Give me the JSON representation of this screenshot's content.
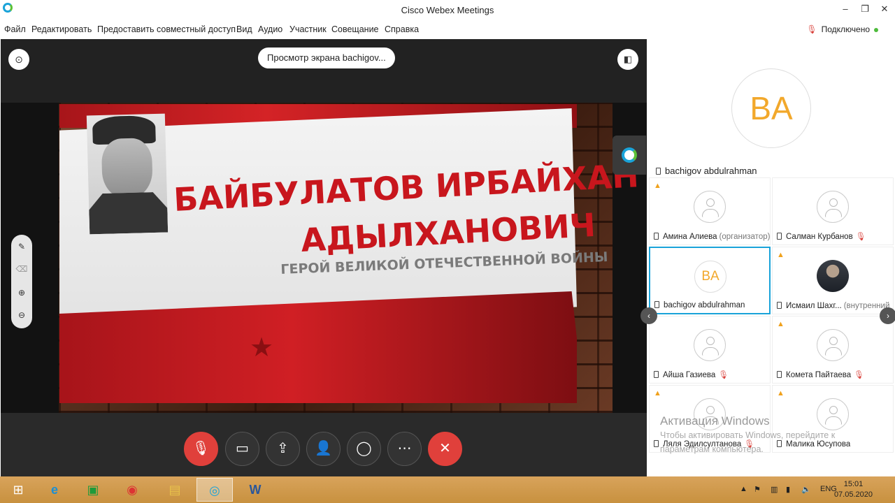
{
  "window": {
    "title": "Cisco Webex Meetings",
    "minimize": "–",
    "restore": "❐",
    "close": "✕"
  },
  "menu": [
    "Файл",
    "Редактировать",
    "Предоставить совместный доступ",
    "Вид",
    "Аудио",
    "Участник",
    "Совещание",
    "Справка"
  ],
  "status": {
    "label": "Подключено",
    "color": "#4dbb3b"
  },
  "stage": {
    "share_label": "Просмотр экрана bachigov...",
    "info_icon": "info-icon",
    "layout_icon": "layout-toggle-icon"
  },
  "slide": {
    "title_line1": "БАЙБУЛАТОВ ИРБАЙХАН",
    "title_line2": "АДЫЛХАНОВИЧ",
    "subtitle": "ГЕРОЙ ВЕЛИКОЙ ОТЕЧЕСТВЕННОЙ ВОЙНЫ",
    "accent": "#c8161d"
  },
  "side_tools": [
    "annotate-icon",
    "eraser-icon",
    "zoom-in-icon",
    "zoom-out-icon"
  ],
  "controls": [
    {
      "name": "mute-button",
      "icon": "microphone-muted-icon",
      "glyph": "🎙",
      "red": true
    },
    {
      "name": "video-button",
      "icon": "camera-off-icon",
      "glyph": "▭",
      "red": false
    },
    {
      "name": "share-button",
      "icon": "share-icon",
      "glyph": "⇪",
      "red": false
    },
    {
      "name": "participants-button",
      "icon": "participants-icon",
      "glyph": "👤",
      "red": false
    },
    {
      "name": "chat-button",
      "icon": "chat-icon",
      "glyph": "◯",
      "red": false
    },
    {
      "name": "more-button",
      "icon": "more-icon",
      "glyph": "⋯",
      "red": false
    },
    {
      "name": "leave-button",
      "icon": "close-icon",
      "glyph": "✕",
      "red": true
    }
  ],
  "panel": {
    "active_speaker_initials": "BA",
    "active_speaker_name": "bachigov abdulrahman",
    "participants": [
      {
        "name": "Амина Алиева",
        "role": "(организатор)",
        "initials": "",
        "muted": false,
        "warn": true,
        "selected": false,
        "photo": false
      },
      {
        "name": "Салман Курбанов",
        "role": "",
        "initials": "",
        "muted": true,
        "warn": false,
        "selected": false,
        "photo": false
      },
      {
        "name": "bachigov abdulrahman",
        "role": "",
        "initials": "BA",
        "muted": false,
        "warn": false,
        "selected": true,
        "photo": false
      },
      {
        "name": "Исмаил Шахг...",
        "role": "(внутренний",
        "initials": "",
        "muted": false,
        "warn": true,
        "selected": false,
        "photo": true
      },
      {
        "name": "Айша Газиева",
        "role": "",
        "initials": "",
        "muted": true,
        "warn": false,
        "selected": false,
        "photo": false
      },
      {
        "name": "Комета Пайтаева",
        "role": "",
        "initials": "",
        "muted": true,
        "warn": true,
        "selected": false,
        "photo": false
      },
      {
        "name": "Ляля Эдилсултанова",
        "role": "",
        "initials": "",
        "muted": true,
        "warn": true,
        "selected": false,
        "photo": false
      },
      {
        "name": "Малика Юсупова",
        "role": "",
        "initials": "",
        "muted": false,
        "warn": true,
        "selected": false,
        "photo": false
      }
    ],
    "watermark_title": "Активация Windows",
    "watermark_line1": "Чтобы активировать Windows, перейдите к",
    "watermark_line2": "параметрам компьютера."
  },
  "taskbar": {
    "apps": [
      "start-button",
      "internet-explorer-icon",
      "store-icon",
      "chrome-icon",
      "file-explorer-icon",
      "webex-icon",
      "word-icon"
    ],
    "lang": "ENG",
    "time": "15:01",
    "date": "07.05.2020"
  }
}
